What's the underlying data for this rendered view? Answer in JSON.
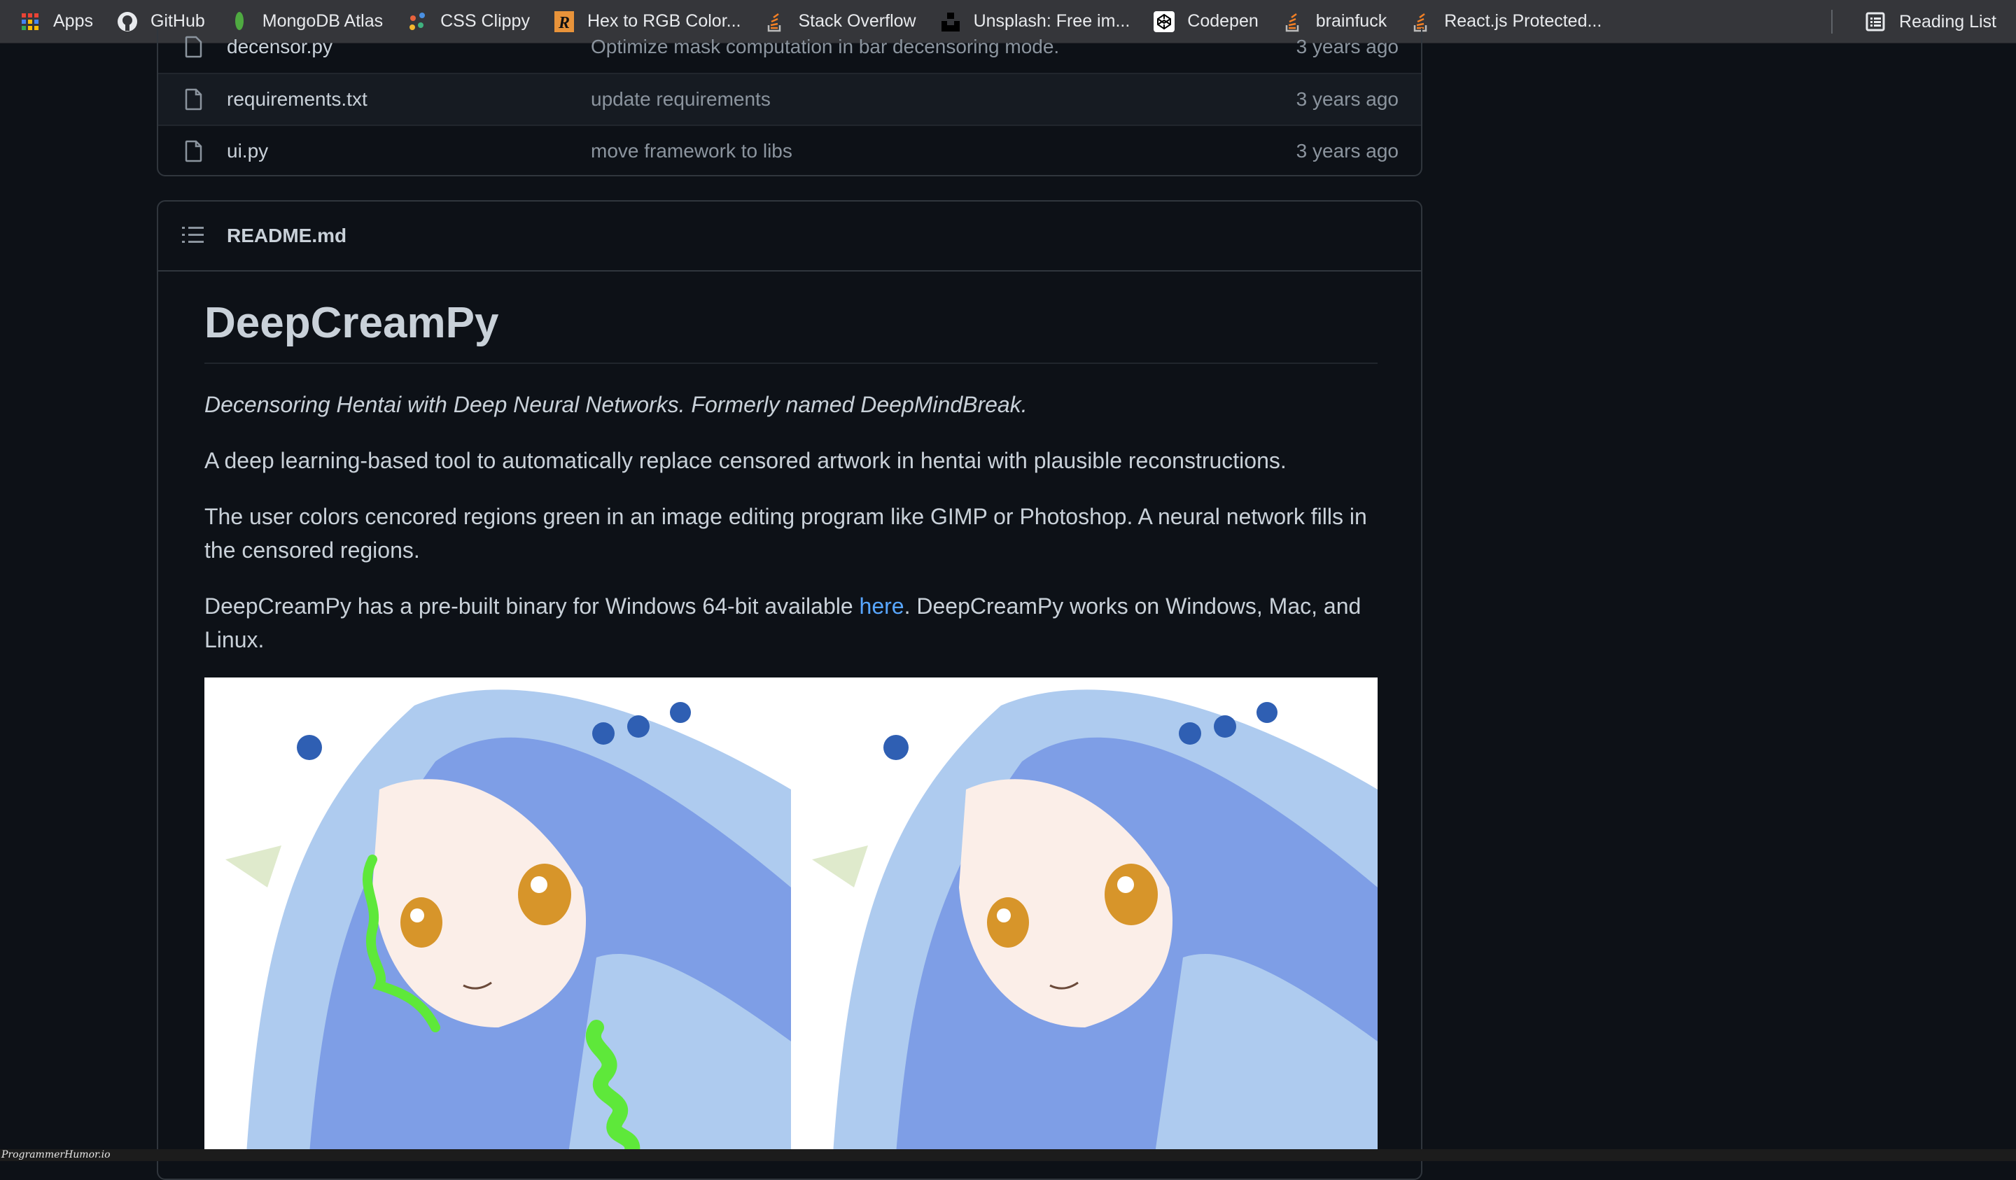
{
  "bookmarks": [
    {
      "label": "Apps",
      "icon": "apps-grid-icon"
    },
    {
      "label": "GitHub",
      "icon": "github-icon"
    },
    {
      "label": "MongoDB Atlas",
      "icon": "mongodb-leaf-icon"
    },
    {
      "label": "CSS Clippy",
      "icon": "css-clippy-icon"
    },
    {
      "label": "Hex to RGB Color...",
      "icon": "r-logo-icon"
    },
    {
      "label": "Stack Overflow",
      "icon": "stackoverflow-icon"
    },
    {
      "label": "Unsplash: Free im...",
      "icon": "unsplash-icon"
    },
    {
      "label": "Codepen",
      "icon": "codepen-icon"
    },
    {
      "label": "brainfuck",
      "icon": "stackoverflow-icon"
    },
    {
      "label": "React.js Protected...",
      "icon": "stackoverflow-icon"
    }
  ],
  "reading_list": {
    "label": "Reading List"
  },
  "files": [
    {
      "name": "decensor.py",
      "message": "Optimize mask computation in bar decensoring mode.",
      "age": "3 years ago"
    },
    {
      "name": "requirements.txt",
      "message": "update requirements",
      "age": "3 years ago"
    },
    {
      "name": "ui.py",
      "message": "move framework to libs",
      "age": "3 years ago"
    }
  ],
  "readme": {
    "filename": "README.md",
    "title": "DeepCreamPy",
    "tagline": "Decensoring Hentai with Deep Neural Networks. Formerly named DeepMindBreak.",
    "para1": "A deep learning-based tool to automatically replace censored artwork in hentai with plausible reconstructions.",
    "para2": "The user colors cencored regions green in an image editing program like GIMP or Photoshop. A neural network fills in the censored regions.",
    "para3_before": "DeepCreamPy has a pre-built binary for Windows 64-bit available ",
    "para3_link": "here",
    "para3_after": ". DeepCreamPy works on Windows, Mac, and Linux.",
    "image_alt_left": "censored example (green marked regions)",
    "image_alt_right": "decensored example"
  },
  "colors": {
    "link": "#58a6ff",
    "mask_green": "#5ee83a"
  },
  "watermark": "ProgrammerHumor.io"
}
